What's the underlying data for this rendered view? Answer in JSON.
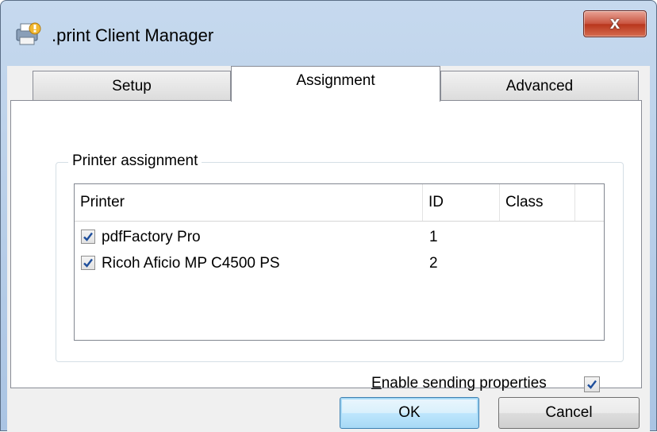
{
  "window": {
    "title": ".print Client Manager",
    "close_label": "x"
  },
  "tabs": [
    {
      "label": "Setup",
      "active": false
    },
    {
      "label": "Assignment",
      "active": true
    },
    {
      "label": "Advanced",
      "active": false
    }
  ],
  "group": {
    "label": "Printer assignment"
  },
  "list": {
    "columns": [
      "Printer",
      "ID",
      "Class"
    ],
    "rows": [
      {
        "checked": true,
        "printer": "pdfFactory Pro",
        "id": "1",
        "class": ""
      },
      {
        "checked": true,
        "printer": "Ricoh Aficio MP C4500 PS",
        "id": "2",
        "class": ""
      }
    ]
  },
  "enable_sending": {
    "label_accel": "E",
    "label_rest": "nable sending properties",
    "checked": true
  },
  "buttons": {
    "ok": "OK",
    "cancel": "Cancel"
  },
  "colors": {
    "checkmark": "#1f4f9c",
    "accent": "#3c7fb1",
    "close": "#c9543f"
  }
}
